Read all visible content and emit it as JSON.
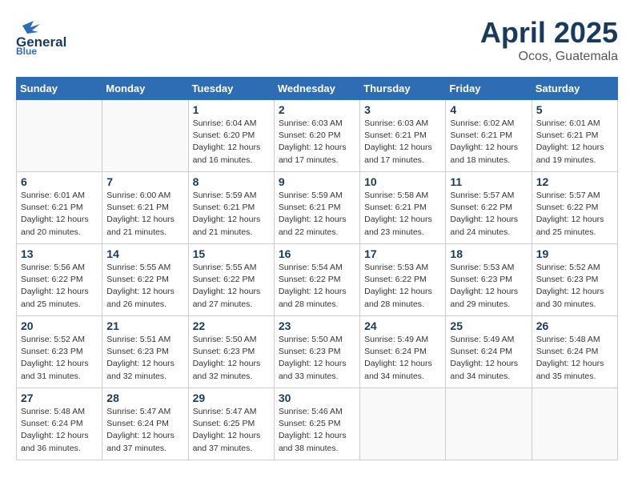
{
  "header": {
    "logo_general": "General",
    "logo_blue": "Blue",
    "month_title": "April 2025",
    "location": "Ocos, Guatemala"
  },
  "days_of_week": [
    "Sunday",
    "Monday",
    "Tuesday",
    "Wednesday",
    "Thursday",
    "Friday",
    "Saturday"
  ],
  "weeks": [
    [
      {
        "day": "",
        "info": ""
      },
      {
        "day": "",
        "info": ""
      },
      {
        "day": "1",
        "info": "Sunrise: 6:04 AM\nSunset: 6:20 PM\nDaylight: 12 hours and 16 minutes."
      },
      {
        "day": "2",
        "info": "Sunrise: 6:03 AM\nSunset: 6:20 PM\nDaylight: 12 hours and 17 minutes."
      },
      {
        "day": "3",
        "info": "Sunrise: 6:03 AM\nSunset: 6:21 PM\nDaylight: 12 hours and 17 minutes."
      },
      {
        "day": "4",
        "info": "Sunrise: 6:02 AM\nSunset: 6:21 PM\nDaylight: 12 hours and 18 minutes."
      },
      {
        "day": "5",
        "info": "Sunrise: 6:01 AM\nSunset: 6:21 PM\nDaylight: 12 hours and 19 minutes."
      }
    ],
    [
      {
        "day": "6",
        "info": "Sunrise: 6:01 AM\nSunset: 6:21 PM\nDaylight: 12 hours and 20 minutes."
      },
      {
        "day": "7",
        "info": "Sunrise: 6:00 AM\nSunset: 6:21 PM\nDaylight: 12 hours and 21 minutes."
      },
      {
        "day": "8",
        "info": "Sunrise: 5:59 AM\nSunset: 6:21 PM\nDaylight: 12 hours and 21 minutes."
      },
      {
        "day": "9",
        "info": "Sunrise: 5:59 AM\nSunset: 6:21 PM\nDaylight: 12 hours and 22 minutes."
      },
      {
        "day": "10",
        "info": "Sunrise: 5:58 AM\nSunset: 6:21 PM\nDaylight: 12 hours and 23 minutes."
      },
      {
        "day": "11",
        "info": "Sunrise: 5:57 AM\nSunset: 6:22 PM\nDaylight: 12 hours and 24 minutes."
      },
      {
        "day": "12",
        "info": "Sunrise: 5:57 AM\nSunset: 6:22 PM\nDaylight: 12 hours and 25 minutes."
      }
    ],
    [
      {
        "day": "13",
        "info": "Sunrise: 5:56 AM\nSunset: 6:22 PM\nDaylight: 12 hours and 25 minutes."
      },
      {
        "day": "14",
        "info": "Sunrise: 5:55 AM\nSunset: 6:22 PM\nDaylight: 12 hours and 26 minutes."
      },
      {
        "day": "15",
        "info": "Sunrise: 5:55 AM\nSunset: 6:22 PM\nDaylight: 12 hours and 27 minutes."
      },
      {
        "day": "16",
        "info": "Sunrise: 5:54 AM\nSunset: 6:22 PM\nDaylight: 12 hours and 28 minutes."
      },
      {
        "day": "17",
        "info": "Sunrise: 5:53 AM\nSunset: 6:22 PM\nDaylight: 12 hours and 28 minutes."
      },
      {
        "day": "18",
        "info": "Sunrise: 5:53 AM\nSunset: 6:23 PM\nDaylight: 12 hours and 29 minutes."
      },
      {
        "day": "19",
        "info": "Sunrise: 5:52 AM\nSunset: 6:23 PM\nDaylight: 12 hours and 30 minutes."
      }
    ],
    [
      {
        "day": "20",
        "info": "Sunrise: 5:52 AM\nSunset: 6:23 PM\nDaylight: 12 hours and 31 minutes."
      },
      {
        "day": "21",
        "info": "Sunrise: 5:51 AM\nSunset: 6:23 PM\nDaylight: 12 hours and 32 minutes."
      },
      {
        "day": "22",
        "info": "Sunrise: 5:50 AM\nSunset: 6:23 PM\nDaylight: 12 hours and 32 minutes."
      },
      {
        "day": "23",
        "info": "Sunrise: 5:50 AM\nSunset: 6:23 PM\nDaylight: 12 hours and 33 minutes."
      },
      {
        "day": "24",
        "info": "Sunrise: 5:49 AM\nSunset: 6:24 PM\nDaylight: 12 hours and 34 minutes."
      },
      {
        "day": "25",
        "info": "Sunrise: 5:49 AM\nSunset: 6:24 PM\nDaylight: 12 hours and 34 minutes."
      },
      {
        "day": "26",
        "info": "Sunrise: 5:48 AM\nSunset: 6:24 PM\nDaylight: 12 hours and 35 minutes."
      }
    ],
    [
      {
        "day": "27",
        "info": "Sunrise: 5:48 AM\nSunset: 6:24 PM\nDaylight: 12 hours and 36 minutes."
      },
      {
        "day": "28",
        "info": "Sunrise: 5:47 AM\nSunset: 6:24 PM\nDaylight: 12 hours and 37 minutes."
      },
      {
        "day": "29",
        "info": "Sunrise: 5:47 AM\nSunset: 6:25 PM\nDaylight: 12 hours and 37 minutes."
      },
      {
        "day": "30",
        "info": "Sunrise: 5:46 AM\nSunset: 6:25 PM\nDaylight: 12 hours and 38 minutes."
      },
      {
        "day": "",
        "info": ""
      },
      {
        "day": "",
        "info": ""
      },
      {
        "day": "",
        "info": ""
      }
    ]
  ]
}
